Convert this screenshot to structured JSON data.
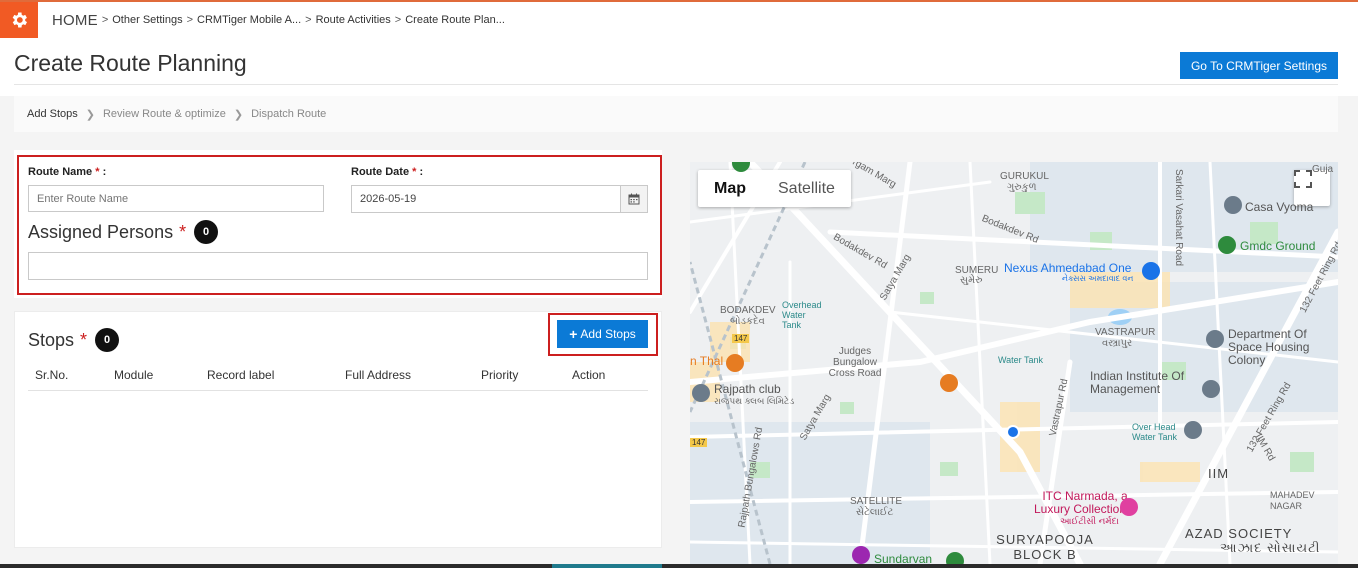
{
  "breadcrumb": {
    "home": "HOME",
    "items": [
      "Other Settings",
      "CRMTiger Mobile A...",
      "Route Activities",
      "Create Route Plan..."
    ]
  },
  "header": {
    "title": "Create Route Planning",
    "settings_button": "Go To CRMTiger Settings"
  },
  "wizard": {
    "steps": [
      "Add Stops",
      "Review Route & optimize",
      "Dispatch Route"
    ]
  },
  "form": {
    "route_name_label": "Route Name",
    "route_name_placeholder": "Enter Route Name",
    "route_date_label": "Route Date",
    "route_date_value": "2026-05-19",
    "required_mark": "*",
    "label_suffix": ":",
    "assigned_label": "Assigned Persons",
    "assigned_count": "0"
  },
  "stops": {
    "title": "Stops",
    "count": "0",
    "add_button": "Add Stops",
    "columns": [
      "Sr.No.",
      "Module",
      "Record label",
      "Full Address",
      "Priority",
      "Action"
    ]
  },
  "map": {
    "type_map": "Map",
    "type_satellite": "Satellite",
    "labels": {
      "gurgam": "rgam Marg",
      "gurukul": "GURUKUL",
      "gurukul_guj": "ગુરુકુળ",
      "sarkari": "Sarkari Vasahat Road",
      "guja": "Guja",
      "casa": "Casa Vyoma",
      "gmdc": "Gmdc Ground",
      "bodakdev_rd1": "Bodakdev Rd",
      "bodakdev_rd2": "Bodakdev Rd",
      "satya_marg1": "Satya Marg",
      "satya_marg2": "Satya Marg",
      "sumeru": "SUMERU",
      "sumeru_guj": "સુમેરુ",
      "nexus": "Nexus Ahmedabad One",
      "nexus_guj": "નેક્સસ અમદાવાદ વન",
      "bodakdev": "BODAKDEV",
      "bodakdev_guj": "બોડકદેવ",
      "overhead1": "Overhead Water Tank",
      "vastrapur": "VASTRAPUR",
      "vastrapur_guj": "વસ્ત્રાપુર",
      "ring_rd1": "132 Feet Ring Rd",
      "ring_rd2": "132 Feet Ring Rd",
      "dept_space": "Department Of Space Housing Colony",
      "thal": "n Thal",
      "judges": "Judges Bungalow Cross Road",
      "water_tank": "Water Tank",
      "rajpath": "Rajpath club",
      "rajpath_guj": "રાજપથ ક્લબ લિમિટેડ",
      "iim_inst": "Indian Institute Of Management",
      "vastrapur_rd": "Vastrapur Rd",
      "overhead2": "Over Head Water Tank",
      "rajpath_rd": "Rajpath Bungalows Rd",
      "iim_rd": "IIM Rd",
      "iim": "IIM",
      "mahadev": "MAHADEV NAGAR",
      "satellite": "SATELLITE",
      "satellite_guj": "સેટેલાઈટ",
      "itc": "ITC Narmada, a Luxury Collection...",
      "itc_guj": "આઈટીસી નર્મદા",
      "azad": "AZAD SOCIETY",
      "azad_guj": "આઝાદ સોસાયટી",
      "suryapooja": "SURYAPOOJA BLOCK B",
      "sundarvan": "Sundarvan",
      "route_147a": "147",
      "route_147b": "147"
    }
  },
  "colors": {
    "primary": "#0b7ad6",
    "accent": "#f15a24",
    "required": "#cc1f1f",
    "highlight_box": "#cc1f1f"
  }
}
